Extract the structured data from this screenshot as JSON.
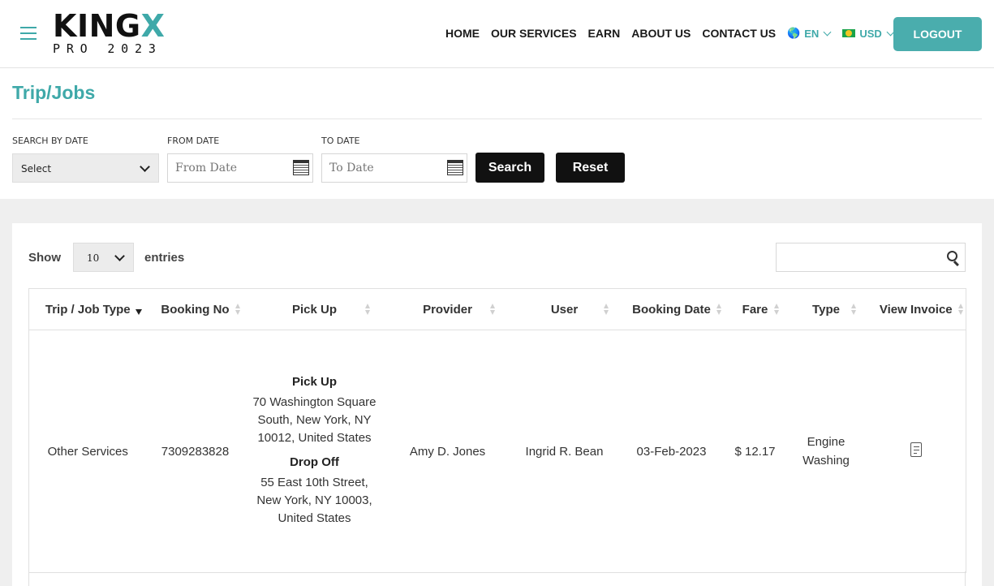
{
  "logo": {
    "main_a": "KING",
    "main_b": "X",
    "sub": "PRO 2023"
  },
  "nav": {
    "items": [
      "HOME",
      "OUR SERVICES",
      "EARN",
      "ABOUT US",
      "CONTACT US"
    ],
    "language": "EN",
    "currency": "USD",
    "logout": "LOGOUT"
  },
  "page": {
    "title": "Trip/Jobs"
  },
  "filters": {
    "search_by_date_label": "SEARCH BY DATE",
    "search_by_date_value": "Select",
    "from_date_label": "FROM DATE",
    "from_date_placeholder": "From Date",
    "to_date_label": "TO DATE",
    "to_date_placeholder": "To Date",
    "search_button": "Search",
    "reset_button": "Reset"
  },
  "table_controls": {
    "show_label": "Show",
    "entries_value": "10",
    "entries_label": "entries",
    "search_value": ""
  },
  "table": {
    "columns": [
      "Trip / Job Type",
      "Booking No",
      "Pick Up",
      "Provider",
      "User",
      "Booking Date",
      "Fare",
      "Type",
      "View Invoice"
    ],
    "rows": [
      {
        "trip_type": "Other Services",
        "booking_no": "7309283828",
        "pickup_heading": "Pick Up",
        "pickup_address": "70 Washington Square South, New York, NY 10012, United States",
        "dropoff_heading": "Drop Off",
        "dropoff_address": "55 East 10th Street, New York, NY 10003, United States",
        "provider": "Amy D. Jones",
        "user": "Ingrid R. Bean",
        "booking_date": "03-Feb-2023",
        "fare": "$ 12.17",
        "type": "Engine Washing",
        "invoice_icon": "invoice-icon"
      }
    ]
  }
}
